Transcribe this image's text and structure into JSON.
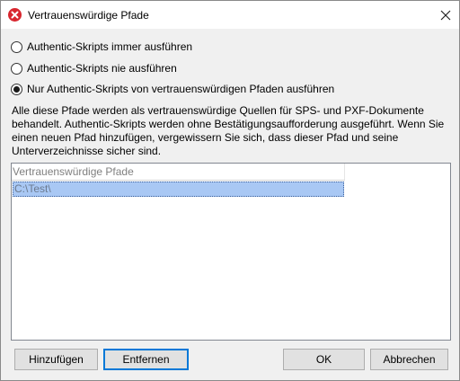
{
  "window": {
    "title": "Vertrauenswürdige Pfade"
  },
  "options": [
    {
      "label": "Authentic-Skripts immer ausführen",
      "checked": false
    },
    {
      "label": "Authentic-Skripts nie ausführen",
      "checked": false
    },
    {
      "label": "Nur Authentic-Skripts von vertrauenswürdigen Pfaden ausführen",
      "checked": true
    }
  ],
  "description": [
    "Alle diese Pfade werden als vertrauenswürdige Quellen für SPS- und PXF-Dokumente",
    "behandelt. Authentic-Skripts werden ohne Bestätigungsaufforderung ausgeführt. Wenn Sie",
    "einen neuen Pfad hinzufügen, vergewissern Sie sich, dass dieser Pfad und seine",
    "Unterverzeichnisse sicher sind."
  ],
  "paths_list": {
    "header": "Vertrauenswürdige Pfade",
    "rows": [
      "C:\\Test\\"
    ]
  },
  "buttons": {
    "add": "Hinzufügen",
    "remove": "Entfernen",
    "ok": "OK",
    "cancel": "Abbrechen"
  },
  "colors": {
    "accent": "#0078d7",
    "selection": "#a9c8f4",
    "app_icon": "#d8262e"
  }
}
